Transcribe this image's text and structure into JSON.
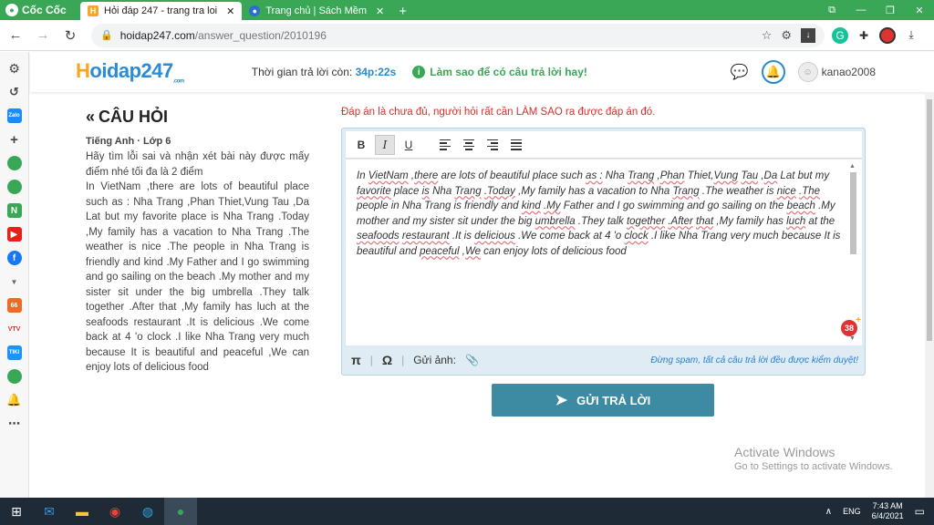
{
  "browser": {
    "brand": "Cốc Cốc",
    "tabs": [
      {
        "label": "Hỏi đáp 247 - trang tra loi",
        "active": true
      },
      {
        "label": "Trang chủ | Sách Mềm",
        "active": false
      }
    ],
    "url_host": "hoidap247.com",
    "url_path": "/answer_question/2010196"
  },
  "header": {
    "logo_h": "H",
    "logo_rest": "oidap247",
    "logo_sub": ".com",
    "timer_label": "Thời gian trả lời còn:",
    "timer_value": "34p:22s",
    "tips": "Làm sao để có câu trả lời hay!",
    "username": "kanao2008"
  },
  "question": {
    "title": "CÂU HỎI",
    "subject": "Tiếng Anh · Lớp 6",
    "text": "Hãy tìm lỗi sai và nhận xét bài này được mấy điểm nhé tối đa là 2 điểm\nIn VietNam ,there are lots of beautiful place such as : Nha Trang ,Phan Thiet,Vung Tau ,Da Lat but my favorite place is Nha Trang .Today ,My family has a vacation to Nha Trang .The weather is nice .The people in Nha Trang is friendly and kind .My Father and I go swimming and go sailing on the beach .My mother and my sister sit under the big umbrella .They talk together .After that ,My family has luch at the  seafoods restaurant .It is delicious .We come back at 4 'o clock .I like Nha Trang very much because It is beautiful and peaceful ,We can enjoy lots of delicious food"
  },
  "answer": {
    "warning": "Đáp án là chưa đủ, người hỏi rất cần LÀM SAO ra được đáp án đó.",
    "segments": [
      {
        "t": "In ",
        "u": false
      },
      {
        "t": "VietNam",
        "u": true
      },
      {
        "t": " ,",
        "u": false
      },
      {
        "t": "there",
        "u": true
      },
      {
        "t": " are lots of beautiful place such ",
        "u": false
      },
      {
        "t": "as :",
        "u": true
      },
      {
        "t": " Nha ",
        "u": false
      },
      {
        "t": "Trang",
        "u": true
      },
      {
        "t": " ,",
        "u": false
      },
      {
        "t": "Phan",
        "u": true
      },
      {
        "t": " Thiet,",
        "u": false
      },
      {
        "t": "Vung",
        "u": true
      },
      {
        "t": " ",
        "u": false
      },
      {
        "t": "Tau",
        "u": true
      },
      {
        "t": " ,",
        "u": false
      },
      {
        "t": "Da",
        "u": true
      },
      {
        "t": " Lat but my ",
        "u": false
      },
      {
        "t": "favorite",
        "u": true
      },
      {
        "t": " place ",
        "u": false
      },
      {
        "t": "is",
        "u": true
      },
      {
        "t": " Nha ",
        "u": false
      },
      {
        "t": "Trang",
        "u": true
      },
      {
        "t": " ",
        "u": false
      },
      {
        "t": ".Today",
        "u": true
      },
      {
        "t": " ,My family has a vacation to Nha ",
        "u": false
      },
      {
        "t": "Trang",
        "u": true
      },
      {
        "t": " .The weather is ",
        "u": false
      },
      {
        "t": "nice",
        "u": true
      },
      {
        "t": " ",
        "u": false
      },
      {
        "t": ".The",
        "u": true
      },
      {
        "t": " people in Nha Trang is friendly and ",
        "u": false
      },
      {
        "t": "kind",
        "u": true
      },
      {
        "t": " ",
        "u": false
      },
      {
        "t": ".My",
        "u": true
      },
      {
        "t": " Father and I go swimming and go sailing on the ",
        "u": false
      },
      {
        "t": "beach",
        "u": true
      },
      {
        "t": " .My mother and my sister sit under the big ",
        "u": false
      },
      {
        "t": "umbrella",
        "u": true
      },
      {
        "t": " .They talk ",
        "u": false
      },
      {
        "t": "together",
        "u": true
      },
      {
        "t": " ",
        "u": false
      },
      {
        "t": ".After",
        "u": true
      },
      {
        "t": " ",
        "u": false
      },
      {
        "t": "that",
        "u": true
      },
      {
        "t": " ,My family has ",
        "u": false
      },
      {
        "t": "luch",
        "u": true
      },
      {
        "t": " at the ",
        "u": false
      },
      {
        "t": "seafoods",
        "u": true
      },
      {
        "t": " ",
        "u": false
      },
      {
        "t": "restaurant",
        "u": true
      },
      {
        "t": " .It is ",
        "u": false
      },
      {
        "t": "delicious",
        "u": true
      },
      {
        "t": " .We come back at 4 'o ",
        "u": false
      },
      {
        "t": "clock",
        "u": true
      },
      {
        "t": " .I like Nha Trang very much because It is beautiful and ",
        "u": false
      },
      {
        "t": "peaceful",
        "u": true
      },
      {
        "t": " ,",
        "u": false
      },
      {
        "t": "We",
        "u": true
      },
      {
        "t": " can enjoy lots of delicious food",
        "u": false
      }
    ],
    "counter": "38",
    "attach_label": "Gửi ảnh:",
    "spam_notice": "Đừng spam, tất cả câu trả lời đều được kiểm duyệt!",
    "submit_label": "GỬI TRẢ LỜI"
  },
  "watermark": {
    "title": "Activate Windows",
    "subtitle": "Go to Settings to activate Windows."
  },
  "taskbar": {
    "language": "ENG",
    "time": "7:43 AM",
    "date": "6/4/2021"
  },
  "colors": {
    "brand_green": "#3aa757",
    "accent_blue": "#2a8bc6",
    "submit_bg": "#3d8aa3",
    "warning_red": "#d0312d"
  }
}
